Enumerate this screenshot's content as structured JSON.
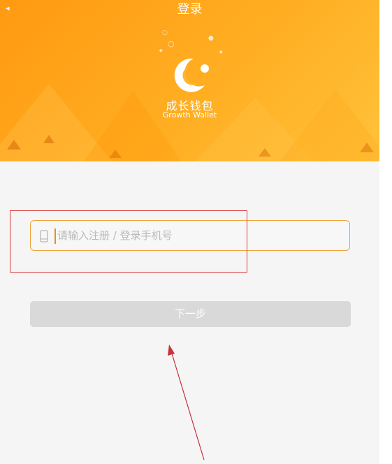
{
  "header": {
    "title": "登录",
    "back_icon": "chevron-left-icon",
    "background_colors": [
      "#ff9a12",
      "#ffc23a"
    ]
  },
  "brand": {
    "name_cn": "成长钱包",
    "name_en": "Growth Wallet",
    "logo_icon": "crescent-swirl-logo"
  },
  "login_form": {
    "phone_placeholder": "请输入注册 / 登录手机号",
    "phone_value": "",
    "phone_icon": "mobile-phone-icon",
    "accent_color": "#f0a23a",
    "next_button_label": "下一步",
    "next_button_color": "#d9d9d9"
  },
  "annotations": {
    "highlight_box_color": "#d93b3b",
    "arrow_color": "#c8323c"
  }
}
